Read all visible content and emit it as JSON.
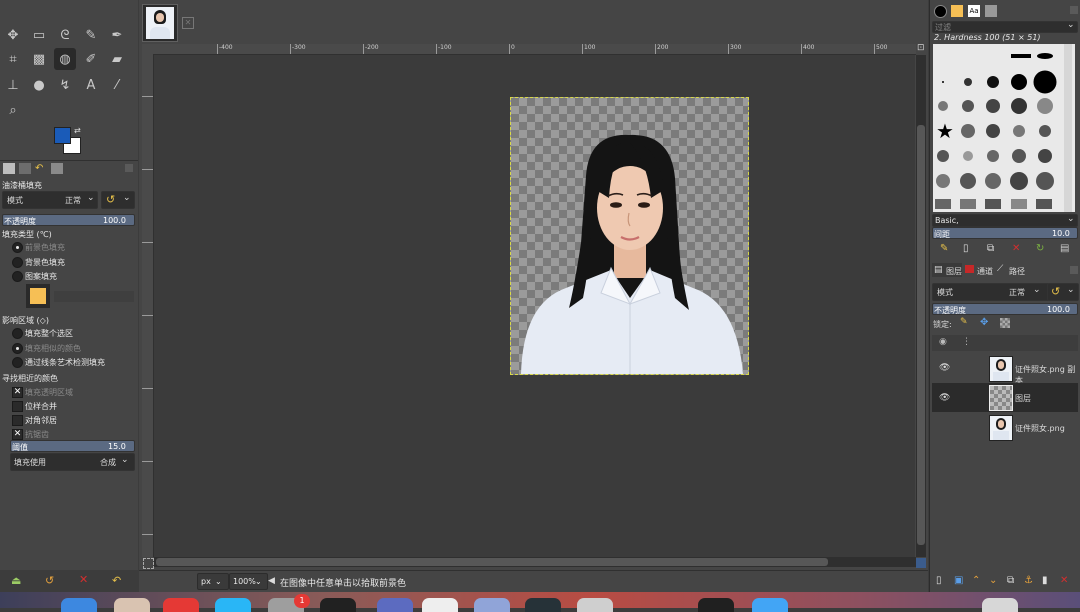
{
  "toolbox": {
    "tool_options_title": "油漆桶填充",
    "mode_label": "模式",
    "mode_value": "正常",
    "opacity_label": "不透明度",
    "opacity_value": "100.0",
    "fill_type_label": "填充类型 (℃)",
    "fill_types": [
      "前景色填充",
      "背景色填充",
      "图案填充"
    ],
    "affected_area_label": "影响区域 (◇)",
    "affected_areas": [
      "填充整个选区",
      "填充相似的颜色",
      "通过线条艺术检测填充"
    ],
    "find_similar_label": "寻找相近的颜色",
    "similar_options": [
      "填充透明区域",
      "位样合并",
      "对角邻居",
      "抗锯齿"
    ],
    "threshold_label": "阈值",
    "threshold_value": "15.0",
    "fill_by_label": "填充使用",
    "fill_by_value": "合成",
    "fg_color": "#1a5bb8",
    "bg_color": "#ffffff",
    "pattern_color": "#f6bf55"
  },
  "canvas": {
    "ruler_marks": [
      "-400",
      "-300",
      "-200",
      "-100",
      "0",
      "100",
      "200",
      "300",
      "400",
      "500",
      "600",
      "700"
    ],
    "unit": "px",
    "zoom": "100%",
    "status_message": "在图像中任意单击以拾取前景色"
  },
  "right_panel": {
    "brush_filter": "过滤",
    "brush_name": "2. Hardness 100 (51 × 51)",
    "brush_preset": "Basic,",
    "spacing_label": "间距",
    "spacing_value": "10.0",
    "tabs": [
      "图层",
      "通道",
      "路径"
    ],
    "layer_mode_label": "模式",
    "layer_mode_value": "正常",
    "layer_opacity_label": "不透明度",
    "layer_opacity_value": "100.0",
    "lock_label": "锁定:",
    "layers": [
      {
        "name": "证件照女.png 副本",
        "visible": true
      },
      {
        "name": "图层",
        "visible": true
      },
      {
        "name": "证件照女.png",
        "visible": false
      }
    ]
  },
  "dock": {
    "badge": "1"
  }
}
